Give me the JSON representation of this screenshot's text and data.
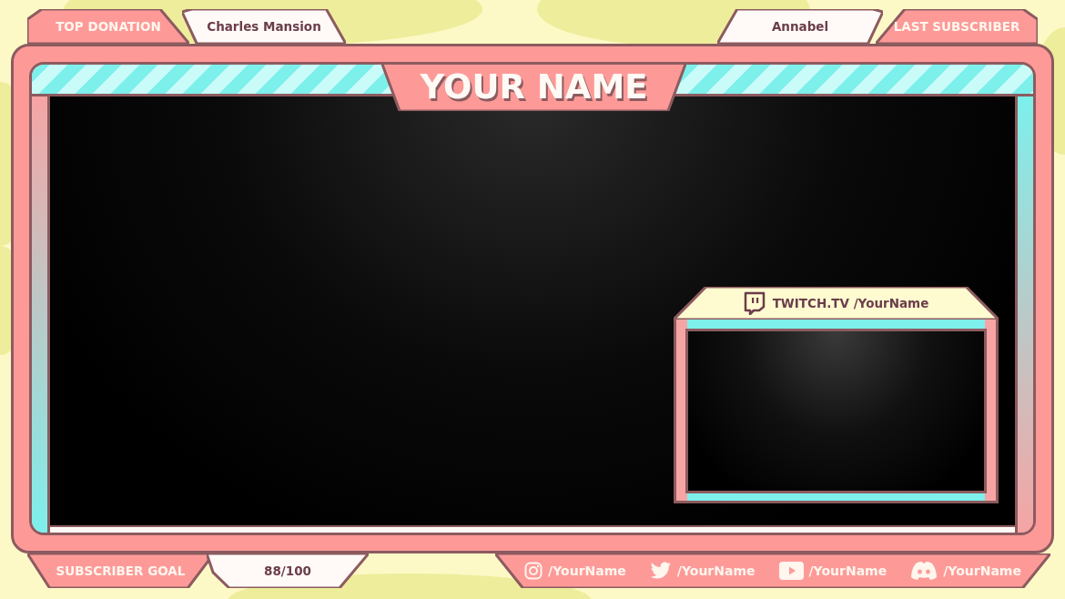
{
  "header": {
    "top_donation": {
      "label": "TOP DONATION",
      "value": "Charles Mansion"
    },
    "last_subscriber": {
      "label": "LAST SUBSCRIBER",
      "value": "Annabel"
    }
  },
  "title": "YOUR NAME",
  "camera": {
    "caption": "TWITCH.TV /YourName"
  },
  "footer": {
    "subscriber_goal": {
      "label": "SUBSCRIBER GOAL",
      "value": "88/100"
    },
    "socials": [
      {
        "kind": "instagram",
        "handle": "/YourName"
      },
      {
        "kind": "twitter",
        "handle": "/YourName"
      },
      {
        "kind": "youtube",
        "handle": "/YourName"
      },
      {
        "kind": "discord",
        "handle": "/YourName"
      }
    ]
  }
}
